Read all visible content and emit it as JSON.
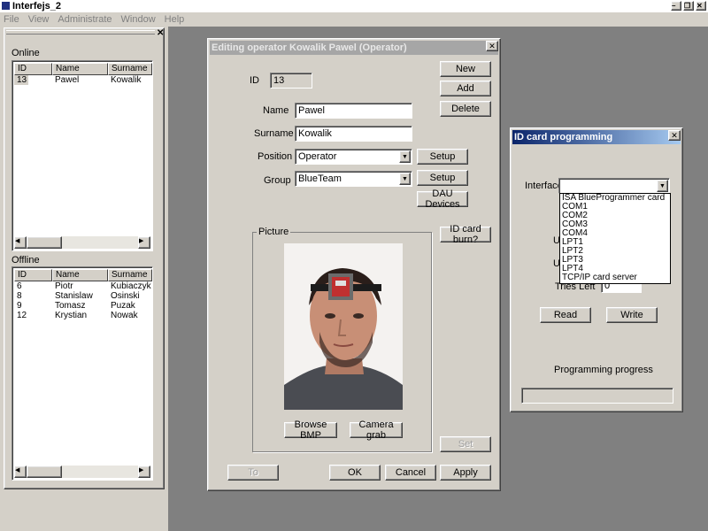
{
  "app": {
    "title": "Interfejs_2",
    "menu": [
      "File",
      "View",
      "Administrate",
      "Window",
      "Help"
    ]
  },
  "left_pane": {
    "online_label": "Online",
    "offline_label": "Offline",
    "columns": [
      "ID",
      "Name",
      "Surname"
    ],
    "online_rows": [
      {
        "id": "13",
        "name": "Pawel",
        "surname": "Kowalik"
      }
    ],
    "offline_rows": [
      {
        "id": "6",
        "name": "Piotr",
        "surname": "Kubiaczyk"
      },
      {
        "id": "8",
        "name": "Stanislaw",
        "surname": "Osinski"
      },
      {
        "id": "9",
        "name": "Tomasz",
        "surname": "Puzak"
      },
      {
        "id": "12",
        "name": "Krystian",
        "surname": "Nowak"
      }
    ]
  },
  "editor": {
    "title": "Editing operator Kowalik Pawel (Operator)",
    "id_label": "ID",
    "id_value": "13",
    "name_label": "Name",
    "name_value": "Pawel",
    "surname_label": "Surname",
    "surname_value": "Kowalik",
    "position_label": "Position",
    "position_value": "Operator",
    "group_label": "Group",
    "group_value": "BlueTeam",
    "picture_label": "Picture",
    "buttons": {
      "new": "New",
      "add": "Add",
      "delete": "Delete",
      "setup_position": "Setup",
      "setup_group": "Setup",
      "dau_devices": "DAU Devices",
      "id_card_burn": "ID card burn?",
      "browse_bmp": "Browse BMP",
      "camera_grab": "Camera grab",
      "set": "Set",
      "to": "To",
      "ok": "OK",
      "cancel": "Cancel",
      "apply": "Apply"
    }
  },
  "card_dialog": {
    "title": "ID card programming",
    "interface_label": "Interface",
    "interface_value": "",
    "options": [
      "ISA BlueProgrammer card",
      "COM1",
      "COM2",
      "COM3",
      "COM4",
      "LPT1",
      "LPT2",
      "LPT3",
      "LPT4",
      "TCP/IP card server"
    ],
    "tries_left_label": "Tries Left",
    "tries_left_value": "0",
    "read_button": "Read",
    "write_button": "Write",
    "progress_label": "Programming progress",
    "progress": 0
  }
}
